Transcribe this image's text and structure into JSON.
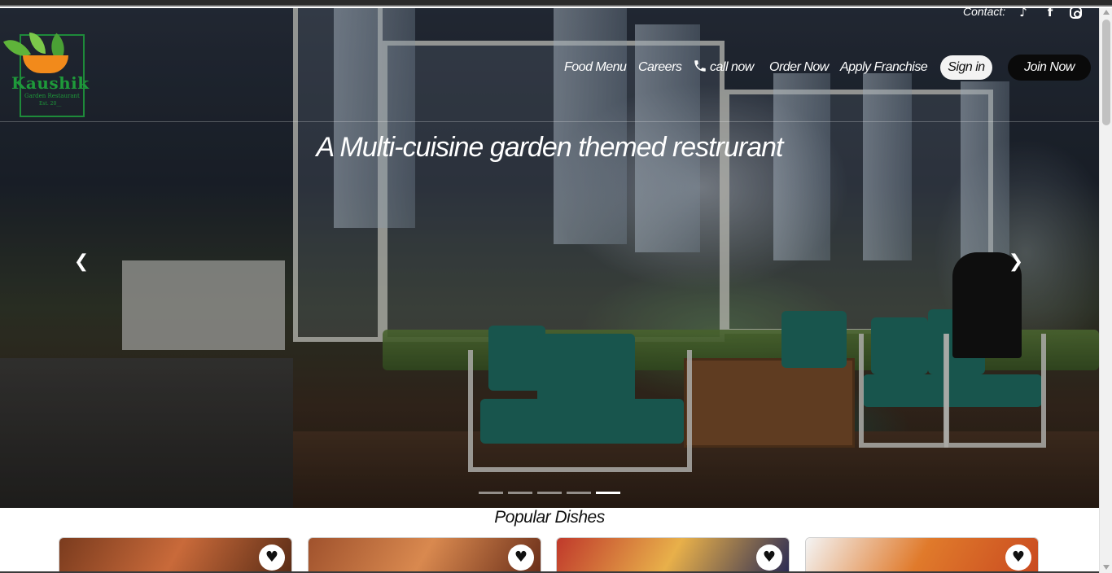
{
  "brand": {
    "name": "Kaushik",
    "subtitle": "Garden Restaurant",
    "tagline": "Est. 20__"
  },
  "contact": {
    "label": "Contact:",
    "icons": [
      "tiktok-icon",
      "facebook-icon",
      "instagram-icon"
    ]
  },
  "nav": {
    "items": [
      {
        "label": "Food Menu"
      },
      {
        "label": "Careers"
      },
      {
        "label": "call now",
        "icon": "phone-icon"
      },
      {
        "label": "Order Now"
      },
      {
        "label": "Apply Franchise"
      }
    ],
    "signin_label": "Sign in",
    "join_label": "Join Now"
  },
  "hero": {
    "title": "A Multi-cuisine garden themed restrurant",
    "prev_icon": "chevron-left-icon",
    "next_icon": "chevron-right-icon",
    "slide_count": 5,
    "active_slide": 5
  },
  "popular": {
    "title": "Popular Dishes",
    "dishes": [
      {
        "colors": [
          "#7a3b1e",
          "#c96a3a",
          "#5a2c16"
        ]
      },
      {
        "colors": [
          "#a0522d",
          "#d9894f",
          "#6b2f1a"
        ]
      },
      {
        "colors": [
          "#c0392b",
          "#e8b04a",
          "#2c2c54"
        ]
      },
      {
        "colors": [
          "#f4f4f4",
          "#e07a2b",
          "#c94a20"
        ]
      }
    ],
    "fav_icon": "heart-icon"
  }
}
